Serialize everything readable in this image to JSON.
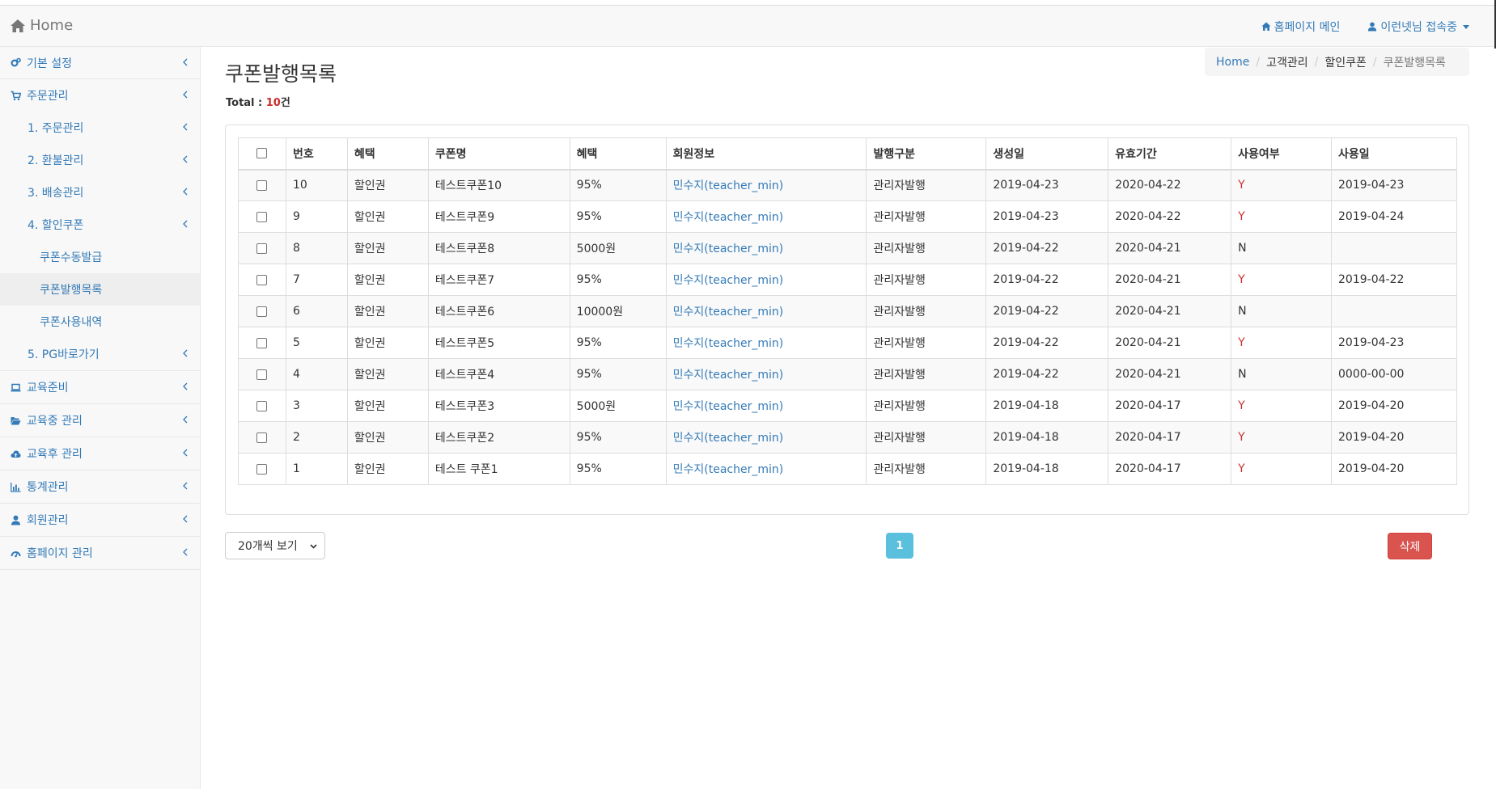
{
  "navbar": {
    "brand": "Home",
    "homepage_main": "홈페이지 메인",
    "user_status": "이런넷님 접속중"
  },
  "sidebar": {
    "items": [
      {
        "label": "기본 설정",
        "icon": "cogs-icon"
      },
      {
        "label": "주문관리",
        "icon": "cart-icon"
      },
      {
        "label": "교육준비",
        "icon": "laptop-icon"
      },
      {
        "label": "교육중 관리",
        "icon": "folder-open-icon"
      },
      {
        "label": "교육후 관리",
        "icon": "cloud-upload-icon"
      },
      {
        "label": "통계관리",
        "icon": "bar-chart-icon"
      },
      {
        "label": "회원관리",
        "icon": "user-icon"
      },
      {
        "label": "홈페이지 관리",
        "icon": "dashboard-icon"
      }
    ],
    "order_sub": [
      {
        "label": "1. 주문관리"
      },
      {
        "label": "2. 환불관리"
      },
      {
        "label": "3. 배송관리"
      },
      {
        "label": "4. 할인쿠폰"
      },
      {
        "label": "5. PG바로가기"
      }
    ],
    "coupon_sub": [
      {
        "label": "쿠폰수동발급"
      },
      {
        "label": "쿠폰발행목록",
        "active": true
      },
      {
        "label": "쿠폰사용내역"
      }
    ]
  },
  "page": {
    "title": "쿠폰발행목록",
    "total_label": "Total : ",
    "total_count": "10",
    "total_unit": "건"
  },
  "breadcrumb": [
    "Home",
    "고객관리",
    "할인쿠폰",
    "쿠폰발행목록"
  ],
  "table": {
    "headers": [
      "번호",
      "혜택",
      "쿠폰명",
      "혜택",
      "회원정보",
      "발행구분",
      "생성일",
      "유효기간",
      "사용여부",
      "사용일"
    ],
    "rows": [
      {
        "no": "10",
        "type": "할인권",
        "name": "테스트쿠폰10",
        "benefit": "95%",
        "member": "민수지(teacher_min)",
        "issue": "관리자발행",
        "created": "2019-04-23",
        "valid": "2020-04-22",
        "used": "Y",
        "used_date": "2019-04-23"
      },
      {
        "no": "9",
        "type": "할인권",
        "name": "테스트쿠폰9",
        "benefit": "95%",
        "member": "민수지(teacher_min)",
        "issue": "관리자발행",
        "created": "2019-04-23",
        "valid": "2020-04-22",
        "used": "Y",
        "used_date": "2019-04-24"
      },
      {
        "no": "8",
        "type": "할인권",
        "name": "테스트쿠폰8",
        "benefit": "5000원",
        "member": "민수지(teacher_min)",
        "issue": "관리자발행",
        "created": "2019-04-22",
        "valid": "2020-04-21",
        "used": "N",
        "used_date": ""
      },
      {
        "no": "7",
        "type": "할인권",
        "name": "테스트쿠폰7",
        "benefit": "95%",
        "member": "민수지(teacher_min)",
        "issue": "관리자발행",
        "created": "2019-04-22",
        "valid": "2020-04-21",
        "used": "Y",
        "used_date": "2019-04-22"
      },
      {
        "no": "6",
        "type": "할인권",
        "name": "테스트쿠폰6",
        "benefit": "10000원",
        "member": "민수지(teacher_min)",
        "issue": "관리자발행",
        "created": "2019-04-22",
        "valid": "2020-04-21",
        "used": "N",
        "used_date": ""
      },
      {
        "no": "5",
        "type": "할인권",
        "name": "테스트쿠폰5",
        "benefit": "95%",
        "member": "민수지(teacher_min)",
        "issue": "관리자발행",
        "created": "2019-04-22",
        "valid": "2020-04-21",
        "used": "Y",
        "used_date": "2019-04-23"
      },
      {
        "no": "4",
        "type": "할인권",
        "name": "테스트쿠폰4",
        "benefit": "95%",
        "member": "민수지(teacher_min)",
        "issue": "관리자발행",
        "created": "2019-04-22",
        "valid": "2020-04-21",
        "used": "N",
        "used_date": "0000-00-00"
      },
      {
        "no": "3",
        "type": "할인권",
        "name": "테스트쿠폰3",
        "benefit": "5000원",
        "member": "민수지(teacher_min)",
        "issue": "관리자발행",
        "created": "2019-04-18",
        "valid": "2020-04-17",
        "used": "Y",
        "used_date": "2019-04-20"
      },
      {
        "no": "2",
        "type": "할인권",
        "name": "테스트쿠폰2",
        "benefit": "95%",
        "member": "민수지(teacher_min)",
        "issue": "관리자발행",
        "created": "2019-04-18",
        "valid": "2020-04-17",
        "used": "Y",
        "used_date": "2019-04-20"
      },
      {
        "no": "1",
        "type": "할인권",
        "name": "테스트 쿠폰1",
        "benefit": "95%",
        "member": "민수지(teacher_min)",
        "issue": "관리자발행",
        "created": "2019-04-18",
        "valid": "2020-04-17",
        "used": "Y",
        "used_date": "2019-04-20"
      }
    ]
  },
  "controls": {
    "page_size": "20개씩 보기",
    "current_page": "1",
    "delete_label": "삭제"
  },
  "colors": {
    "link": "#337ab7",
    "used_yes": "#c9302c",
    "delete": "#d9534f",
    "pager_active": "#5bc0de"
  }
}
